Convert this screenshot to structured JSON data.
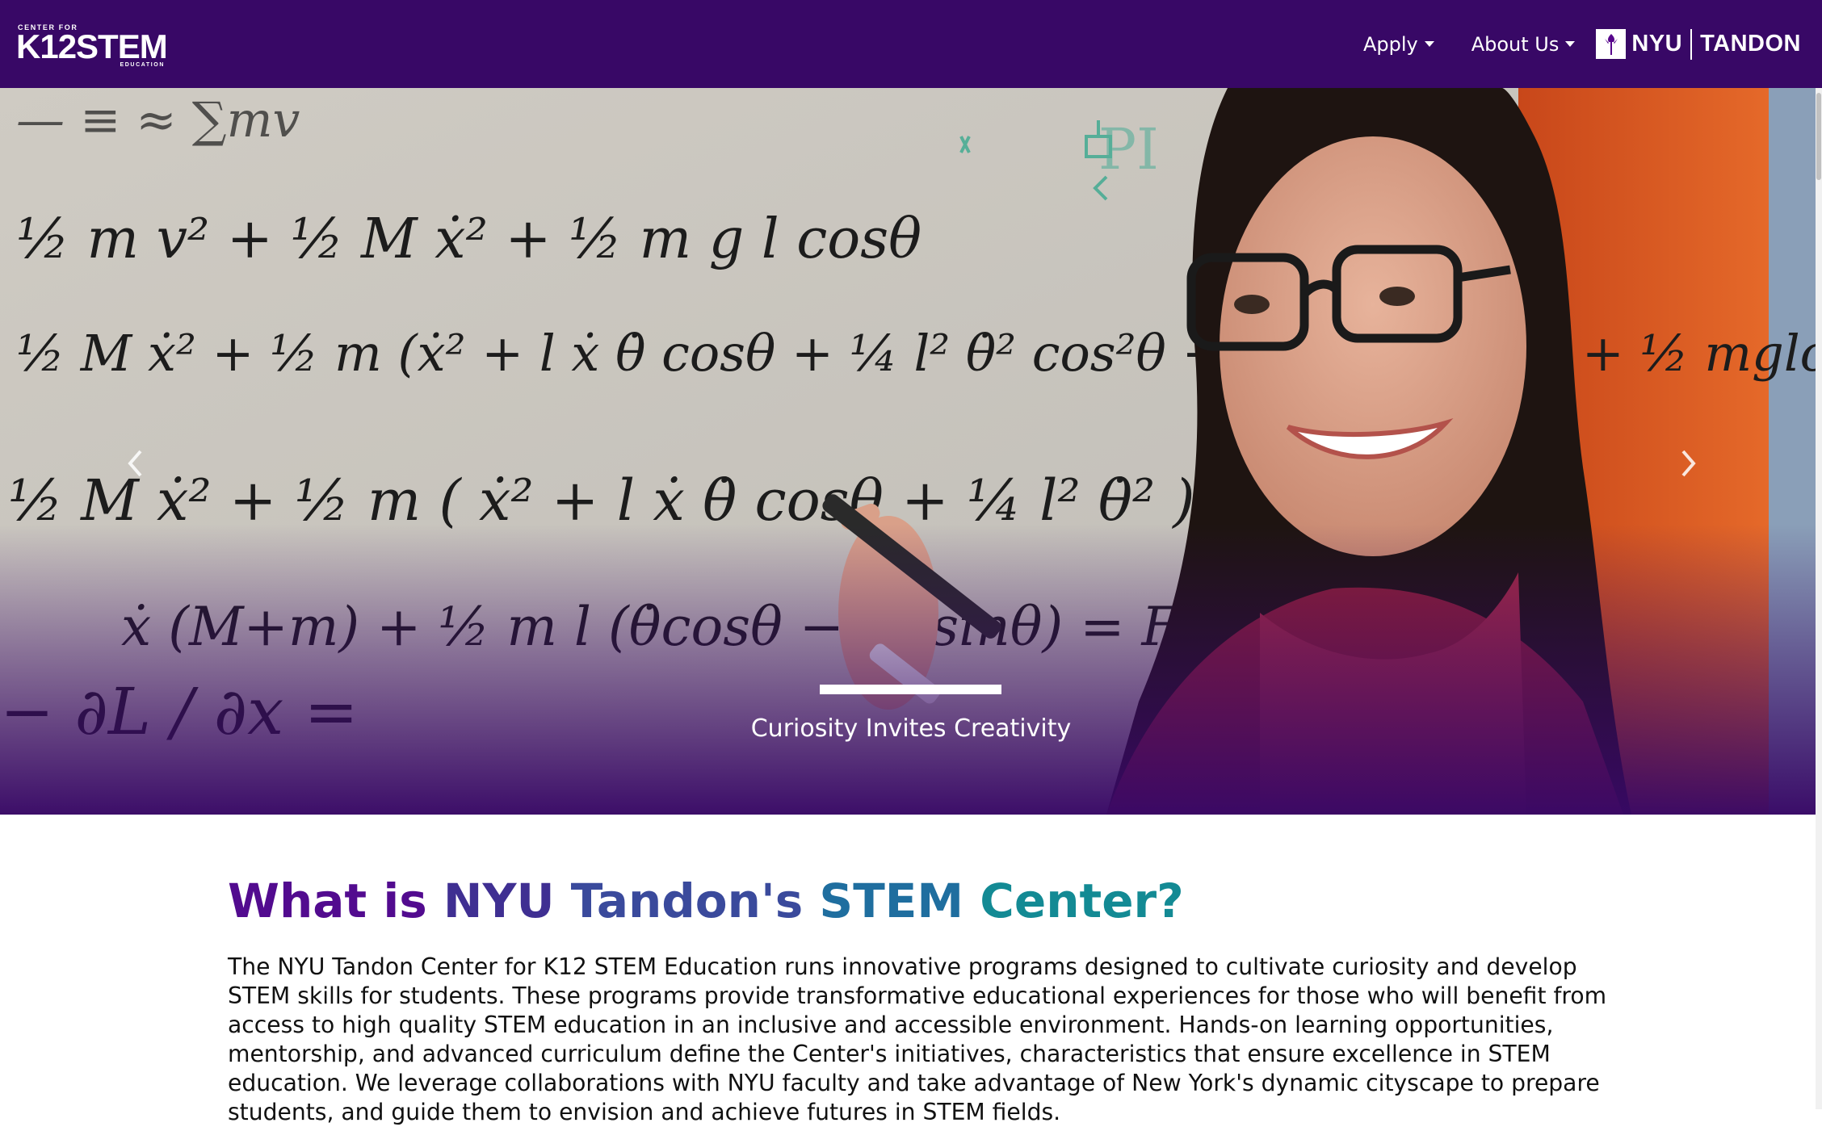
{
  "navbar": {
    "logo": {
      "top": "CENTER FOR",
      "main": "K12STEM",
      "bottom": "EDUCATION"
    },
    "links": [
      {
        "label": "Apply"
      },
      {
        "label": "About Us"
      }
    ],
    "nyu_logo": {
      "left": "NYU",
      "right": "TANDON"
    }
  },
  "hero": {
    "caption": "Curiosity Invites Creativity",
    "prev_icon": "chevron-left-icon",
    "next_icon": "chevron-right-icon"
  },
  "main": {
    "headline_parts": [
      "What is ",
      "NYU ",
      "Tandon's ",
      "STEM ",
      "Center?"
    ],
    "headline_colors": [
      "#520b8f",
      "#3f2f92",
      "#3a4a9c",
      "#1f6e9f",
      "#138a94"
    ],
    "intro": "The NYU Tandon Center for K12 STEM Education runs innovative programs designed to cultivate curiosity and develop STEM skills for students. These programs provide transformative educational experiences for those who will benefit from access to high quality STEM education in an inclusive and accessible environment. Hands-on learning opportunities, mentorship, and advanced curriculum define the Center's initiatives, characteristics that ensure excellence in STEM education. We leverage collaborations with NYU faculty and take advantage of New York's dynamic cityscape to prepare students, and guide them to envision and achieve futures in STEM fields."
  },
  "colors": {
    "brand_purple": "#380866",
    "accent_orange": "#e2581f"
  }
}
